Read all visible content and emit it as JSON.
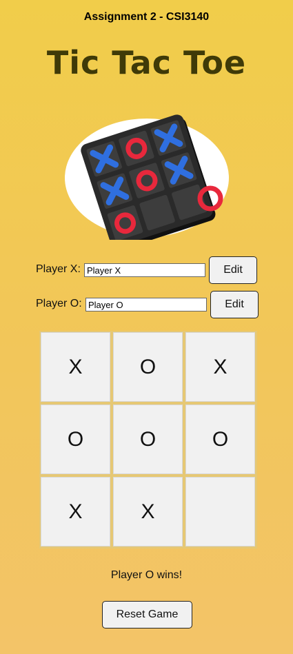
{
  "header": {
    "subtitle": "Assignment 2 - CSI3140",
    "title": "Tic Tac Toe"
  },
  "hero_image": {
    "icon": "tic-tac-toe-board-image"
  },
  "players": {
    "x": {
      "label": "Player X:",
      "value": "Player X",
      "edit_label": "Edit"
    },
    "o": {
      "label": "Player O:",
      "value": "Player O",
      "edit_label": "Edit"
    }
  },
  "board": {
    "cells": [
      "X",
      "O",
      "X",
      "O",
      "O",
      "O",
      "X",
      "X",
      ""
    ]
  },
  "status": "Player O wins!",
  "reset_label": "Reset Game",
  "colors": {
    "background_top": "#f1cd4a",
    "background_bottom": "#f3c468",
    "title": "#3f3a08",
    "cell": "#f1f1f1",
    "board_gap": "#e6c874"
  }
}
